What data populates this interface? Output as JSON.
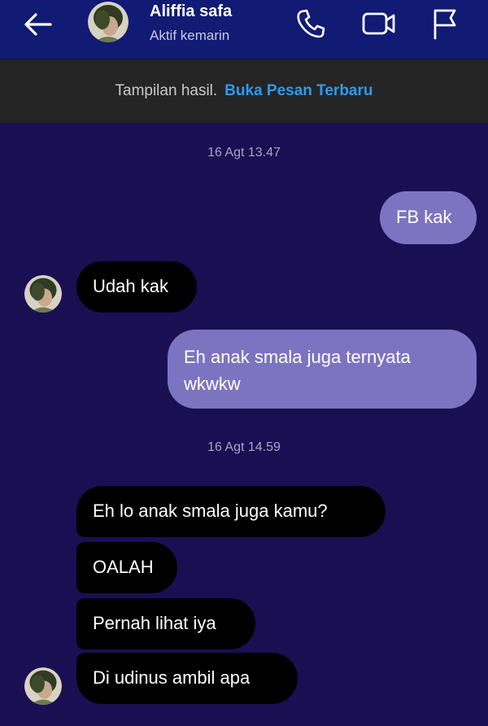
{
  "header": {
    "contact_name": "Aliffia safa",
    "status": "Aktif kemarin",
    "icons": [
      "back-arrow-icon",
      "phone-icon",
      "video-camera-icon",
      "flag-icon"
    ]
  },
  "banner": {
    "text": "Tampilan hasil.",
    "link": "Buka Pesan Terbaru"
  },
  "messages": [
    {
      "type": "timestamp",
      "text": "16 Agt 13.47"
    },
    {
      "type": "outgoing",
      "text": "FB kak"
    },
    {
      "type": "incoming",
      "text": "Udah kak"
    },
    {
      "type": "outgoing",
      "text": "Eh anak smala juga ternyata wkwkw"
    },
    {
      "type": "timestamp",
      "text": "16 Agt 14.59"
    },
    {
      "type": "incoming",
      "text": "Eh lo anak smala juga kamu?"
    },
    {
      "type": "incoming",
      "text": "OALAH"
    },
    {
      "type": "incoming",
      "text": "Pernah lihat iya"
    },
    {
      "type": "incoming",
      "text": "Di udinus ambil apa"
    }
  ],
  "colors": {
    "header_bg": "#111b73",
    "chat_bg": "#1a0f52",
    "banner_bg": "#242424",
    "link": "#2d9bf0",
    "outgoing_bubble": "#7d74c1",
    "incoming_bubble": "#000000"
  }
}
